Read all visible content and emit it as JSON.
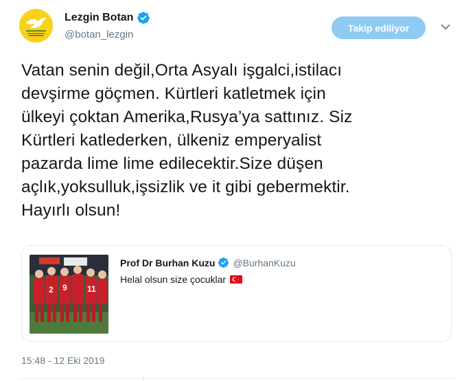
{
  "author": {
    "display_name": "Lezgin Botan",
    "handle": "@botan_lezgin",
    "avatar_icon": "dove-logo-icon",
    "avatar_color": "#f7d21b",
    "verified": true
  },
  "follow_button": {
    "label": "Takip ediliyor",
    "color": "#8fcaf3"
  },
  "tweet": {
    "lines": [
      "Vatan senin değil,Orta Asyalı işgalci,istilacı",
      "devşirme göçmen. Kürtleri katletmek için",
      "ülkeyi çoktan Amerika,Rusya’ya sattınız. Siz",
      "Kürtleri katlederken, ülkeniz emperyalist",
      "pazarda lime lime edilecektir.Size düşen",
      "açlık,yoksulluk,işsizlik ve it gibi gebermektir.",
      "Hayırlı olsun!"
    ],
    "timestamp": "15:48 - 12 Eki 2019"
  },
  "quoted_tweet": {
    "display_name": "Prof Dr Burhan Kuzu",
    "handle": "@BurhanKuzu",
    "verified": true,
    "text": "Helal olsun size çocuklar",
    "emoji": "turkey-flag-icon",
    "image_icon": "football-team-saluting-photo",
    "jersey_numbers": [
      "2",
      "9",
      "11"
    ]
  },
  "colors": {
    "verified_blue": "#1da1f2",
    "secondary_text": "#657786",
    "border": "#e1e8ed"
  }
}
